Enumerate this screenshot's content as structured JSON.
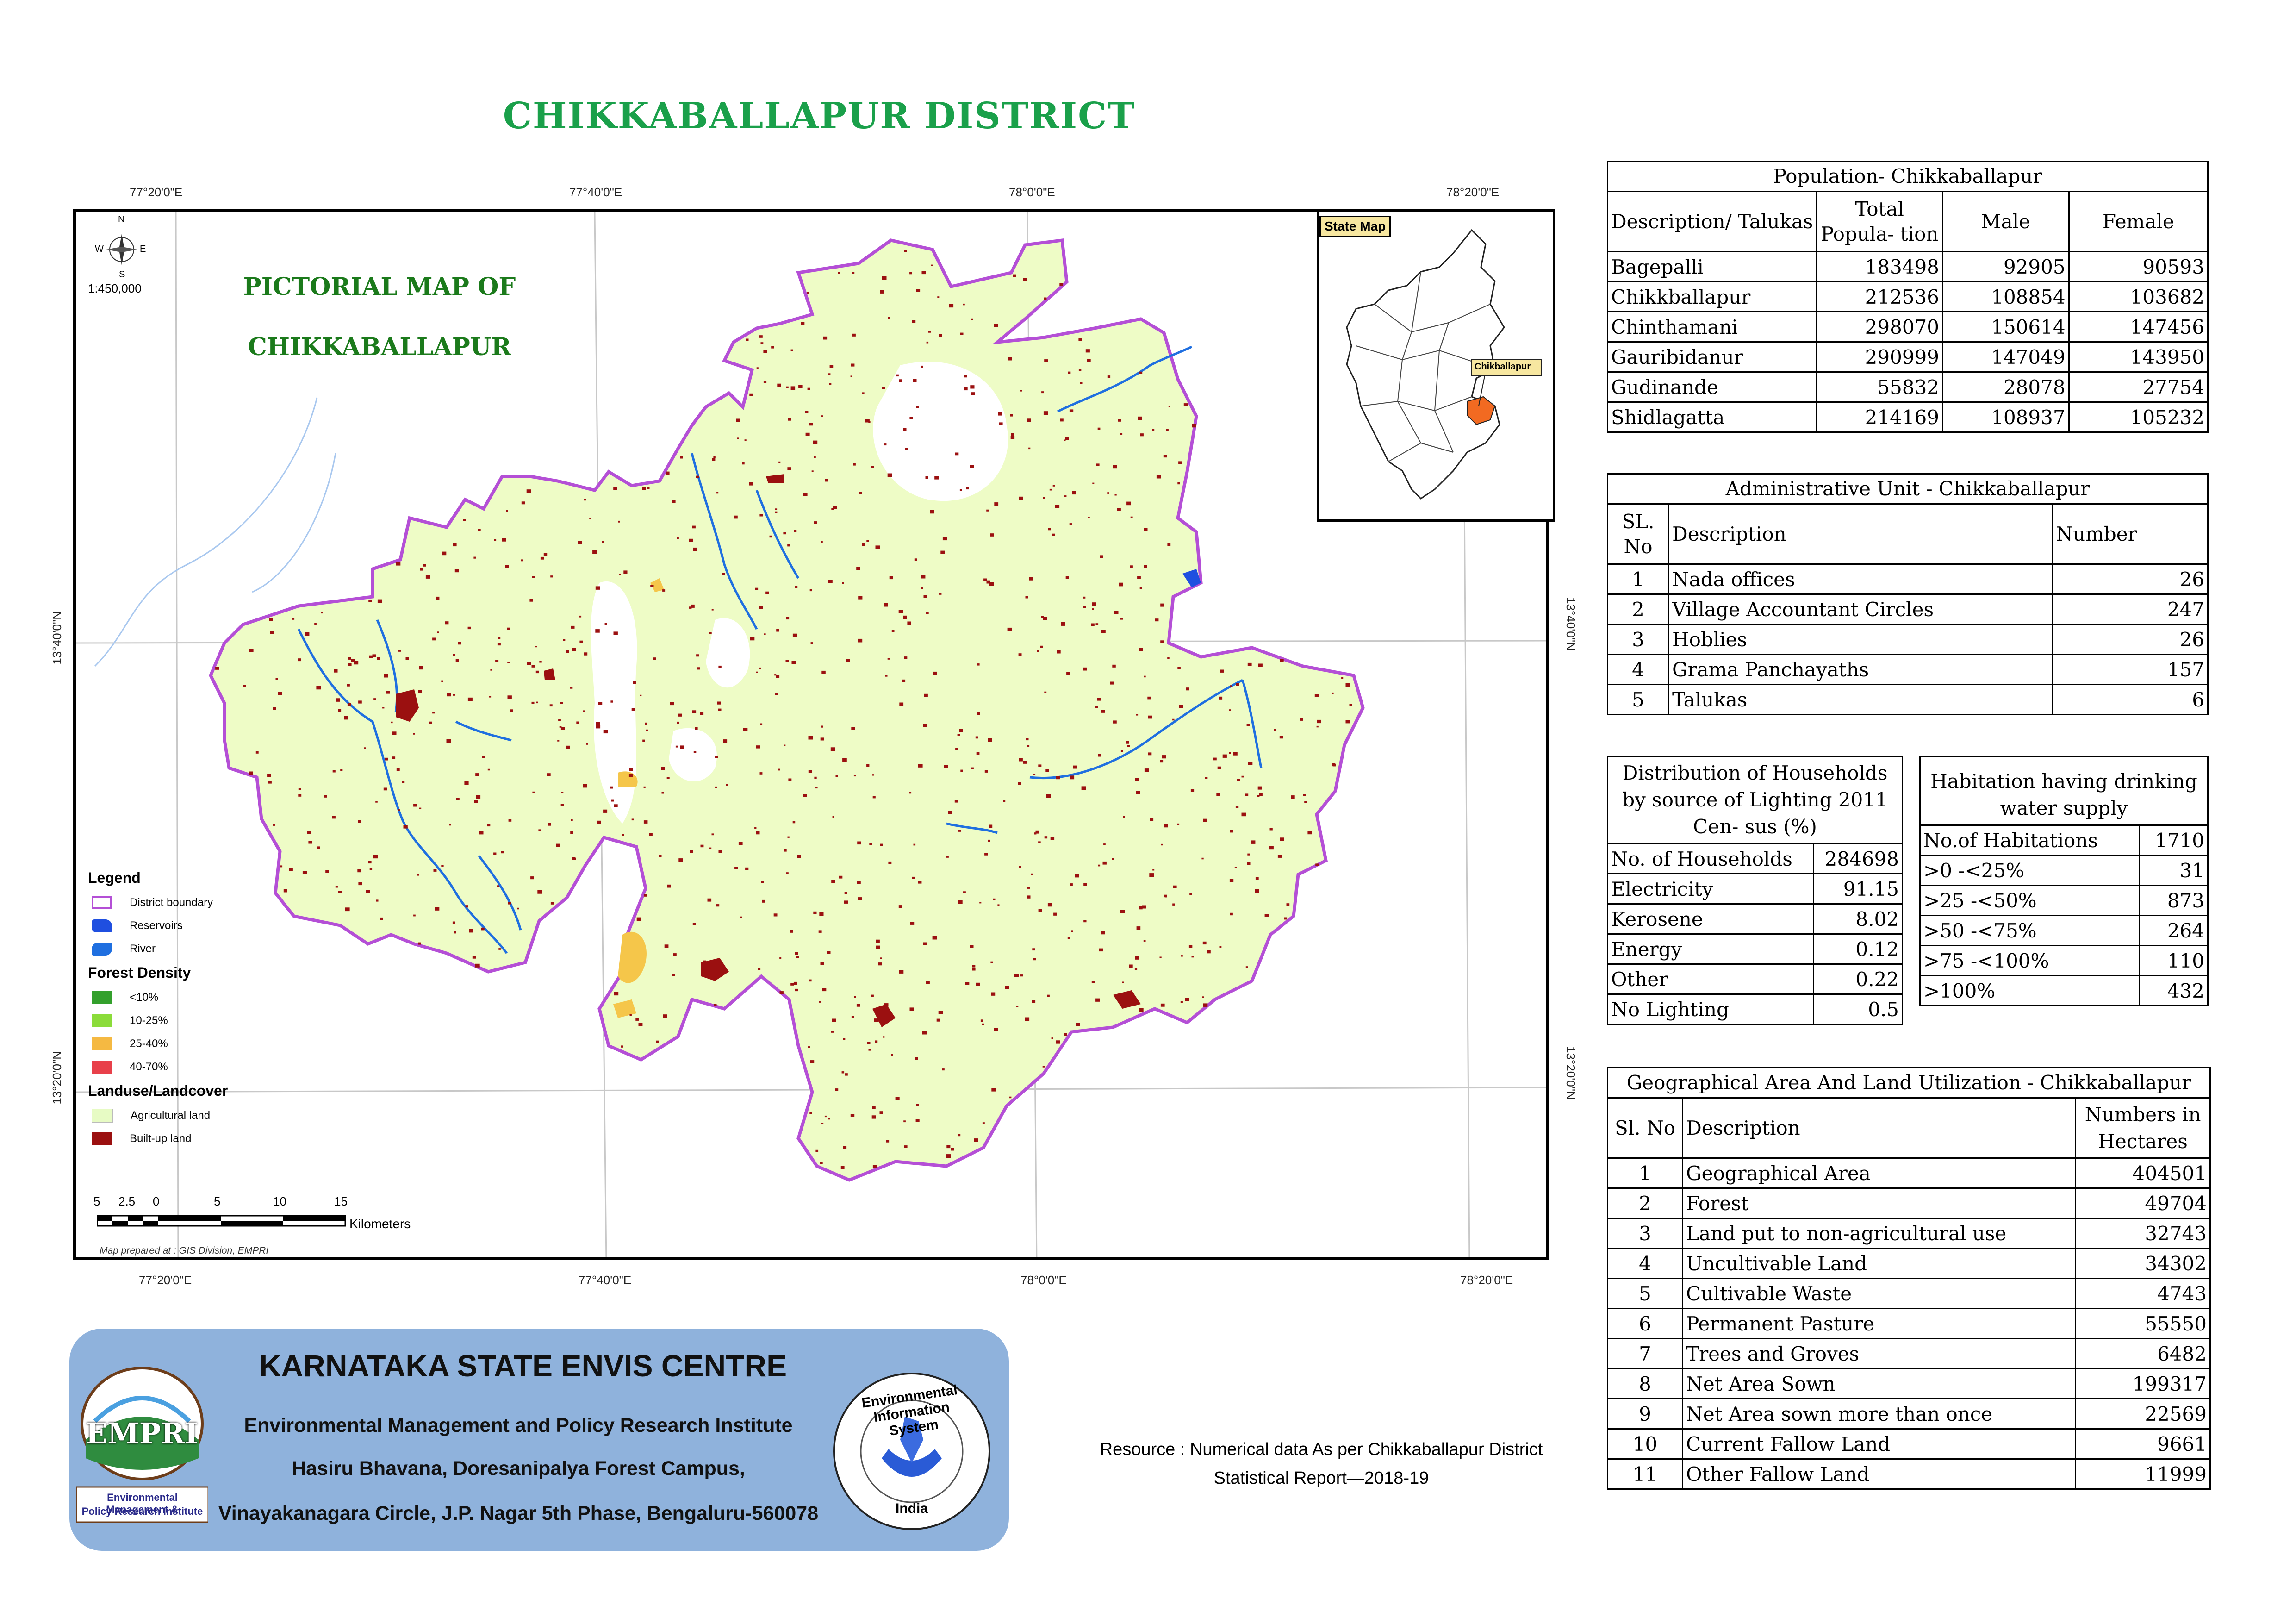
{
  "title": "CHIKKABALLAPUR DISTRICT",
  "map": {
    "pictorial_title_line1": "PICTORIAL MAP OF",
    "pictorial_title_line2": "CHIKKABALLAPUR",
    "scale_ratio": "1:450,000",
    "compass": {
      "n": "N",
      "s": "S",
      "e": "E",
      "w": "W"
    },
    "top_coords": [
      "77°20'0\"E",
      "77°40'0\"E",
      "78°0'0\"E",
      "78°20'0\"E"
    ],
    "bottom_coords": [
      "77°20'0\"E",
      "77°40'0\"E",
      "78°0'0\"E",
      "78°20'0\"E"
    ],
    "left_coords": [
      "13°40'0\"N",
      "13°20'0\"N"
    ],
    "right_coords": [
      "13°40'0\"N",
      "13°20'0\"N"
    ],
    "scale_ticks": [
      "5",
      "2.5",
      "0",
      "5",
      "10",
      "15"
    ],
    "scale_unit": "Kilometers",
    "credit": "Map prepared at : GIS Division, EMPRI",
    "colors": {
      "boundary": "#b44fd6",
      "agri": "#f0fccb",
      "builtup": "#9b1010",
      "river": "#1f6fe0",
      "forest_25_40": "#f5c64a"
    },
    "legend": {
      "title": "Legend",
      "items": [
        {
          "label": "District boundary",
          "color": "#b44fd6"
        },
        {
          "label": "Reservoirs",
          "color": "#1f4fe0"
        },
        {
          "label": "River",
          "color": "#1f6fe0"
        }
      ],
      "forest_title": "Forest Density",
      "forest_items": [
        {
          "label": "<10%",
          "color": "#33a02c"
        },
        {
          "label": "10-25%",
          "color": "#8bdc3a"
        },
        {
          "label": "25-40%",
          "color": "#f5b942"
        },
        {
          "label": "40-70%",
          "color": "#e8404a"
        }
      ],
      "landuse_title": "Landuse/Landcover",
      "landuse_items": [
        {
          "label": "Agricultural land",
          "color": "#e7fbc4"
        },
        {
          "label": "Built-up land",
          "color": "#9b1010"
        }
      ]
    },
    "inset": {
      "label": "State Map",
      "district_label": "Chikballapur",
      "district_color": "#f26a21"
    }
  },
  "population": {
    "caption": "Population- Chikkaballapur",
    "headers": [
      "Description/ Talukas",
      "Total Popula- tion",
      "Male",
      "Female"
    ],
    "rows": [
      [
        "Bagepalli",
        "183498",
        "92905",
        "90593"
      ],
      [
        "Chikkballapur",
        "212536",
        "108854",
        "103682"
      ],
      [
        "Chinthamani",
        "298070",
        "150614",
        "147456"
      ],
      [
        "Gauribidanur",
        "290999",
        "147049",
        "143950"
      ],
      [
        "Gudinande",
        "55832",
        "28078",
        "27754"
      ],
      [
        "Shidlagatta",
        "214169",
        "108937",
        "105232"
      ]
    ]
  },
  "admin": {
    "caption": "Administrative Unit - Chikkaballapur",
    "headers": [
      "SL. No",
      "Description",
      "Number"
    ],
    "rows": [
      [
        "1",
        "Nada offices",
        "26"
      ],
      [
        "2",
        "Village Accountant Circles",
        "247"
      ],
      [
        "3",
        "Hoblies",
        "26"
      ],
      [
        "4",
        "Grama Panchayaths",
        "157"
      ],
      [
        "5",
        "Talukas",
        "6"
      ]
    ]
  },
  "lighting": {
    "caption": "Distribution of Households by source of Lighting 2011 Cen- sus (%)",
    "rows": [
      [
        "No. of Households",
        "284698"
      ],
      [
        "Electricity",
        "91.15"
      ],
      [
        "Kerosene",
        "8.02"
      ],
      [
        "Energy",
        "0.12"
      ],
      [
        "Other",
        "0.22"
      ],
      [
        "No Lighting",
        "0.5"
      ]
    ]
  },
  "habitation": {
    "caption": "Habitation having drinking water supply",
    "rows": [
      [
        "No.of Habitations",
        "1710"
      ],
      [
        ">0 -<25%",
        "31"
      ],
      [
        ">25 -<50%",
        "873"
      ],
      [
        ">50 -<75%",
        "264"
      ],
      [
        ">75 -<100%",
        "110"
      ],
      [
        ">100%",
        "432"
      ]
    ]
  },
  "land": {
    "caption": "Geographical Area  And Land Utilization - Chikkaballapur",
    "headers": [
      "Sl. No",
      "Description",
      "Numbers in Hectares"
    ],
    "rows": [
      [
        "1",
        "Geographical Area",
        "404501"
      ],
      [
        "2",
        "Forest",
        "49704"
      ],
      [
        "3",
        "Land put to non-agricultural use",
        "32743"
      ],
      [
        "4",
        "Uncultivable Land",
        "34302"
      ],
      [
        "5",
        "Cultivable Waste",
        "4743"
      ],
      [
        "6",
        "Permanent Pasture",
        "55550"
      ],
      [
        "7",
        "Trees and Groves",
        "6482"
      ],
      [
        "8",
        "Net Area Sown",
        "199317"
      ],
      [
        "9",
        "Net Area sown more than once",
        "22569"
      ],
      [
        "10",
        "Current Fallow Land",
        "9661"
      ],
      [
        "11",
        "Other Fallow Land",
        "11999"
      ]
    ]
  },
  "envis": {
    "title": "KARNATAKA STATE ENVIS CENTRE",
    "line1": "Environmental Management and Policy Research Institute",
    "line2": "Hasiru Bhavana, Doresanipalya Forest Campus,",
    "line3": "Vinayakanagara Circle, J.P. Nagar 5th Phase, Bengaluru-560078",
    "logo_left_text": "EMPRI",
    "logo_left_caption1": "Environmental Management &",
    "logo_left_caption2": "Policy Research Institute",
    "logo_right_top": "Environmental Information System",
    "logo_right_bottom": "India"
  },
  "resource": {
    "line1": "Resource : Numerical data As per Chikkaballapur District",
    "line2": "Statistical Report—2018-19"
  }
}
